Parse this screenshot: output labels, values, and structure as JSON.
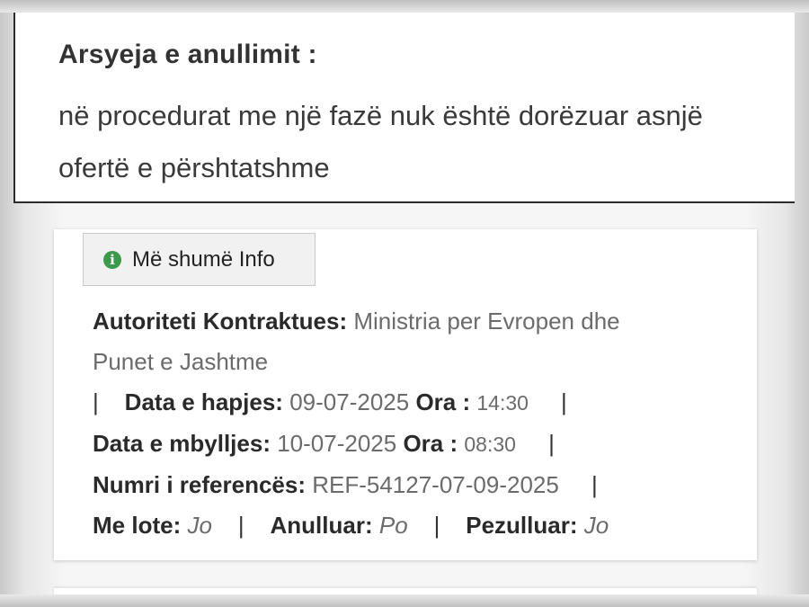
{
  "cancellation": {
    "title": "Arsyeja e anullimit :",
    "line1": "në procedurat me një fazë nuk është dorëzuar asnjë",
    "line2": "ofertë e përshtatshme"
  },
  "more_info_button": {
    "label": "Më shumë Info",
    "icon": "info-icon",
    "icon_color": "#3b9b4b"
  },
  "tender": {
    "authority_label": "Autoriteti Kontraktues:",
    "authority_value_1": "Ministria per Evropen dhe",
    "authority_value_2": "Punet e Jashtme",
    "opening_date_label": "Data e hapjes:",
    "opening_date": "09-07-2025",
    "opening_time_label": "Ora :",
    "opening_time": "14:30",
    "closing_date_label": "Data e mbylljes:",
    "closing_date": "10-07-2025",
    "closing_time_label": "Ora :",
    "closing_time": "08:30",
    "reference_label": "Numri i referencës:",
    "reference": "REF-54127-07-09-2025",
    "lots_label": "Me lote:",
    "lots": "Jo",
    "cancelled_label": "Anulluar:",
    "cancelled": "Po",
    "suspended_label": "Pezulluar:",
    "suspended": "Jo",
    "separator": "|"
  }
}
